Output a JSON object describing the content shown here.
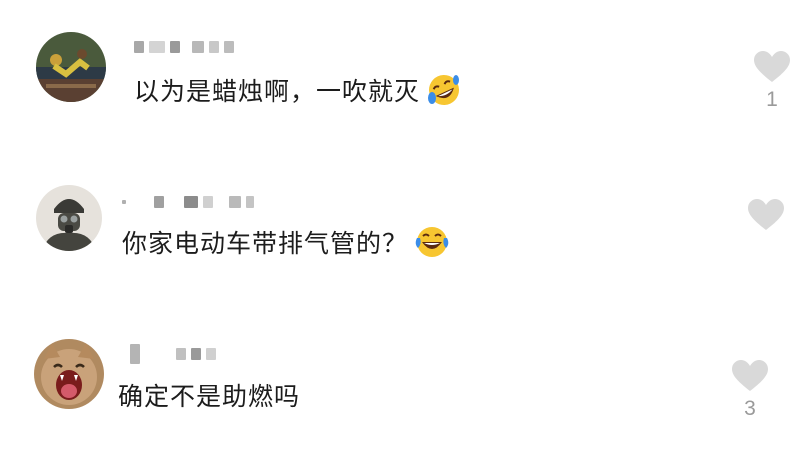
{
  "comments": [
    {
      "text": "以为是蜡烛啊，一吹就灭",
      "emoji": "rolling-on-floor-laughing-emoji",
      "likes": "1",
      "avatar": "runner-athlete-avatar"
    },
    {
      "text": "你家电动车带排气管的？",
      "emoji": "tears-of-joy-emoji",
      "likes": "",
      "avatar": "gas-mask-soldier-avatar"
    },
    {
      "text": "确定不是助燃吗",
      "emoji": "",
      "likes": "3",
      "avatar": "screaming-cat-avatar"
    }
  ],
  "colors": {
    "text": "#1c1c1c",
    "like_icon": "#d9d9d9",
    "like_count": "#9a9a9a",
    "emoji_face": "#f7c631",
    "emoji_tears": "#3b8de8"
  }
}
